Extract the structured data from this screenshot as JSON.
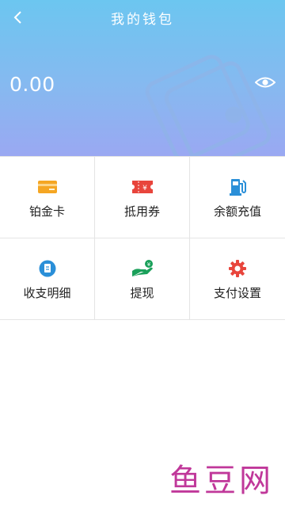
{
  "header": {
    "title": "我的钱包",
    "balance": "0.00",
    "gradient_top": "#6cc6f0",
    "gradient_bottom": "#9aa8f2"
  },
  "icons": {
    "back": "back-arrow-icon",
    "visibility": "eye-icon"
  },
  "menu": [
    {
      "label": "铂金卡",
      "icon": "bank-card-icon",
      "color": "#f5a623"
    },
    {
      "label": "抵用券",
      "icon": "coupon-icon",
      "color": "#e8453c"
    },
    {
      "label": "余额充值",
      "icon": "fuel-pump-icon",
      "color": "#2a8fd8"
    },
    {
      "label": "收支明细",
      "icon": "statement-icon",
      "color": "#2a8fd8"
    },
    {
      "label": "提现",
      "icon": "withdraw-hand-icon",
      "color": "#1aa05a"
    },
    {
      "label": "支付设置",
      "icon": "settings-gear-icon",
      "color": "#e8453c"
    }
  ],
  "watermark": "鱼豆网"
}
